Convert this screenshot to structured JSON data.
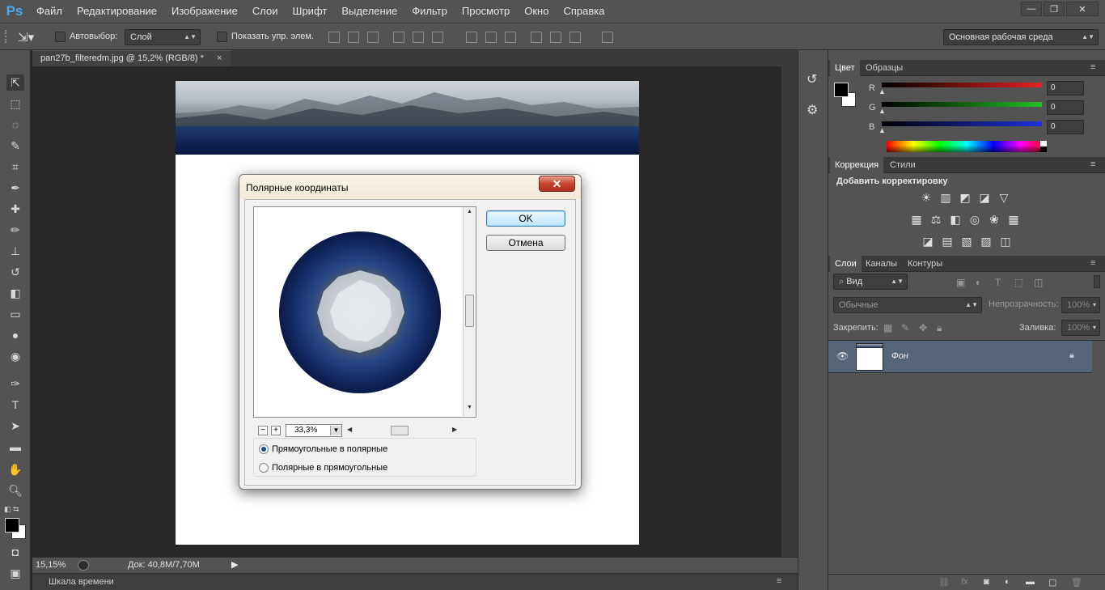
{
  "app": {
    "logo": "Ps"
  },
  "menu": [
    "Файл",
    "Редактирование",
    "Изображение",
    "Слои",
    "Шрифт",
    "Выделение",
    "Фильтр",
    "Просмотр",
    "Окно",
    "Справка"
  ],
  "window_controls": [
    "—",
    "❐",
    "✕"
  ],
  "options": {
    "autoselect_label": "Автовыбор:",
    "autoselect_target": "Слой",
    "show_transform_label": "Показать упр. элем.",
    "workspace": "Основная рабочая среда"
  },
  "document": {
    "tab_title": "pan27b_filteredm.jpg @ 15,2% (RGB/8) *",
    "tab_close": "×"
  },
  "status": {
    "zoom": "15,15%",
    "doc_info": "Док: 40,8M/7,70M"
  },
  "timeline": {
    "label": "Шкала времени"
  },
  "color_panel": {
    "tabs": [
      "Цвет",
      "Образцы"
    ],
    "channels": [
      {
        "label": "R",
        "value": "0",
        "color": "#e82020"
      },
      {
        "label": "G",
        "value": "0",
        "color": "#20c020"
      },
      {
        "label": "B",
        "value": "0",
        "color": "#2030e0"
      }
    ]
  },
  "adjust_panel": {
    "tabs": [
      "Коррекция",
      "Стили"
    ],
    "title": "Добавить корректировку"
  },
  "layers_panel": {
    "tabs": [
      "Слои",
      "Каналы",
      "Контуры"
    ],
    "filter_kind": "Вид",
    "blend_mode": "Обычные",
    "opacity_label": "Непрозрачность:",
    "opacity_value": "100%",
    "lock_label": "Закрепить:",
    "fill_label": "Заливка:",
    "fill_value": "100%",
    "layers": [
      {
        "name": "Фон",
        "visible": true,
        "locked": true
      }
    ]
  },
  "dialog": {
    "title": "Полярные координаты",
    "close": "✕",
    "ok_label": "OK",
    "cancel_label": "Отмена",
    "zoom_value": "33,3%",
    "options": [
      {
        "label": "Прямоугольные в полярные",
        "selected": true
      },
      {
        "label": "Полярные в прямоугольные",
        "selected": false
      }
    ]
  }
}
